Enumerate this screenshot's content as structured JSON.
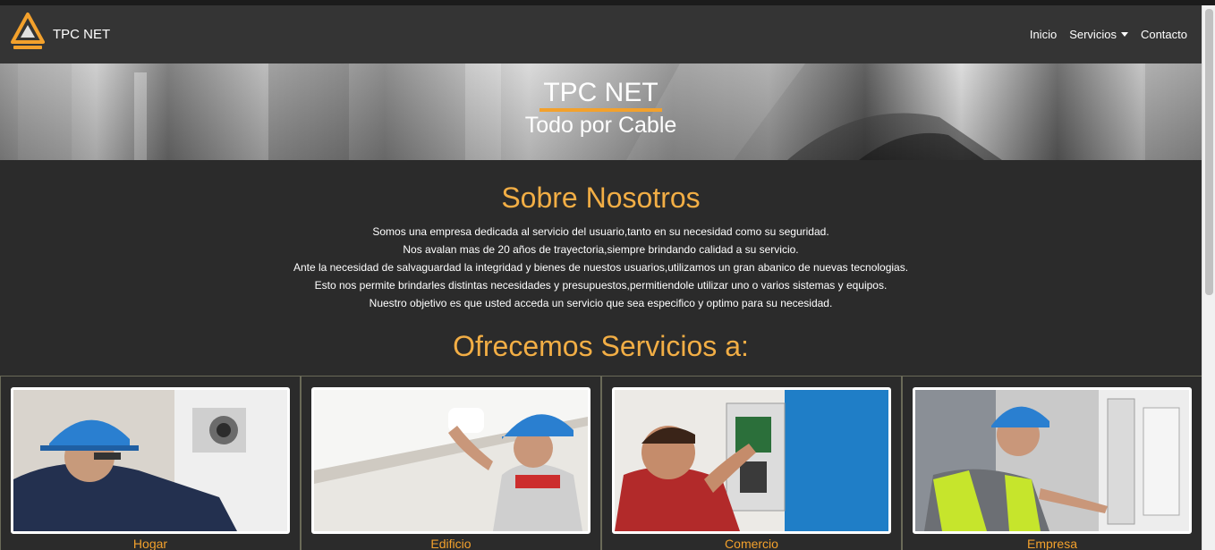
{
  "navbar": {
    "brand": "TPC NET",
    "links": [
      {
        "label": "Inicio"
      },
      {
        "label": "Servicios"
      },
      {
        "label": "Contacto"
      }
    ]
  },
  "hero": {
    "title": "TPC NET",
    "subtitle": "Todo por Cable"
  },
  "about": {
    "title": "Sobre Nosotros",
    "lines": [
      "Somos una empresa dedicada al servicio del usuario,tanto en su necesidad como su seguridad.",
      "Nos avalan mas de 20 años de trayectoria,siempre brindando calidad a su servicio.",
      "Ante la necesidad de salvaguardad la integridad y bienes de nuestos usuarios,utilizamos un gran abanico de nuevas tecnologias.",
      "Esto nos permite brindarles distintas necesidades y presupuestos,permitiendole utilizar uno o varios sistemas y equipos.",
      "Nuestro objetivo es que usted acceda un servicio que sea especifico y optimo para su necesidad."
    ]
  },
  "services": {
    "title": "Ofrecemos Servicios a:",
    "cards": [
      {
        "label": "Hogar"
      },
      {
        "label": "Edificio"
      },
      {
        "label": "Comercio"
      },
      {
        "label": "Empresa"
      }
    ]
  },
  "colors": {
    "accent": "#f3a12c",
    "navbar": "#343434",
    "background": "#2b2b2b"
  }
}
